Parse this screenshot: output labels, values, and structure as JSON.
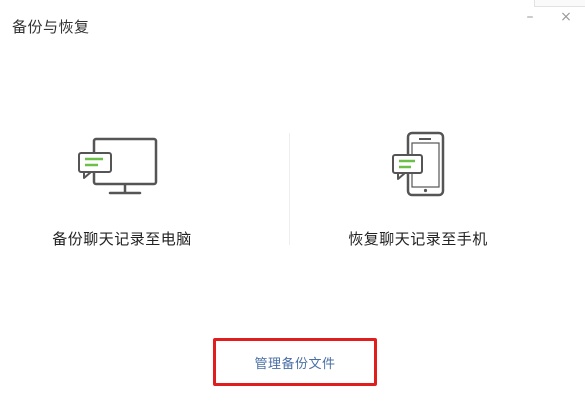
{
  "window": {
    "title": "备份与恢复",
    "minimize_glyph": "–",
    "close_glyph": "×"
  },
  "options": [
    {
      "label": "备份聊天记录至电脑",
      "icon": "monitor-chat-icon"
    },
    {
      "label": "恢复聊天记录至手机",
      "icon": "phone-chat-icon"
    }
  ],
  "manage": {
    "label": "管理备份文件",
    "highlight_color": "#e01e1e"
  },
  "colors": {
    "icon_stroke": "#555555",
    "chat_green": "#6cc04a",
    "link": "#4a6fa5"
  }
}
